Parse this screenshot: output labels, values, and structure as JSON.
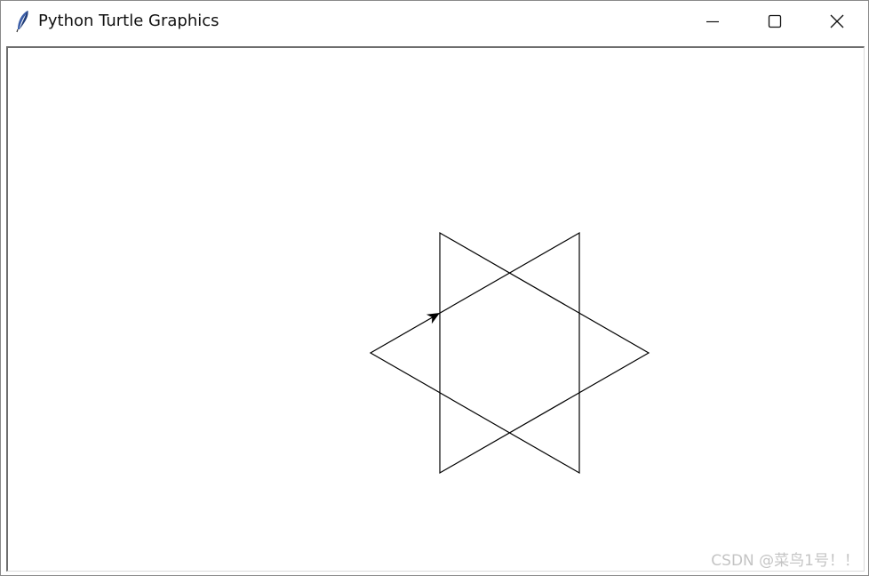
{
  "window": {
    "title": "Python Turtle Graphics",
    "icon": "feather-icon",
    "controls": {
      "minimize_icon": "minimize-icon",
      "maximize_icon": "maximize-icon",
      "close_icon": "close-icon"
    }
  },
  "canvas": {
    "background": "#ffffff",
    "stroke_color": "#000000",
    "drawing": "six-pointed-star",
    "turtle_icon": "turtle-arrow-icon"
  },
  "watermark": {
    "text": "CSDN @菜鸟1号！！"
  }
}
